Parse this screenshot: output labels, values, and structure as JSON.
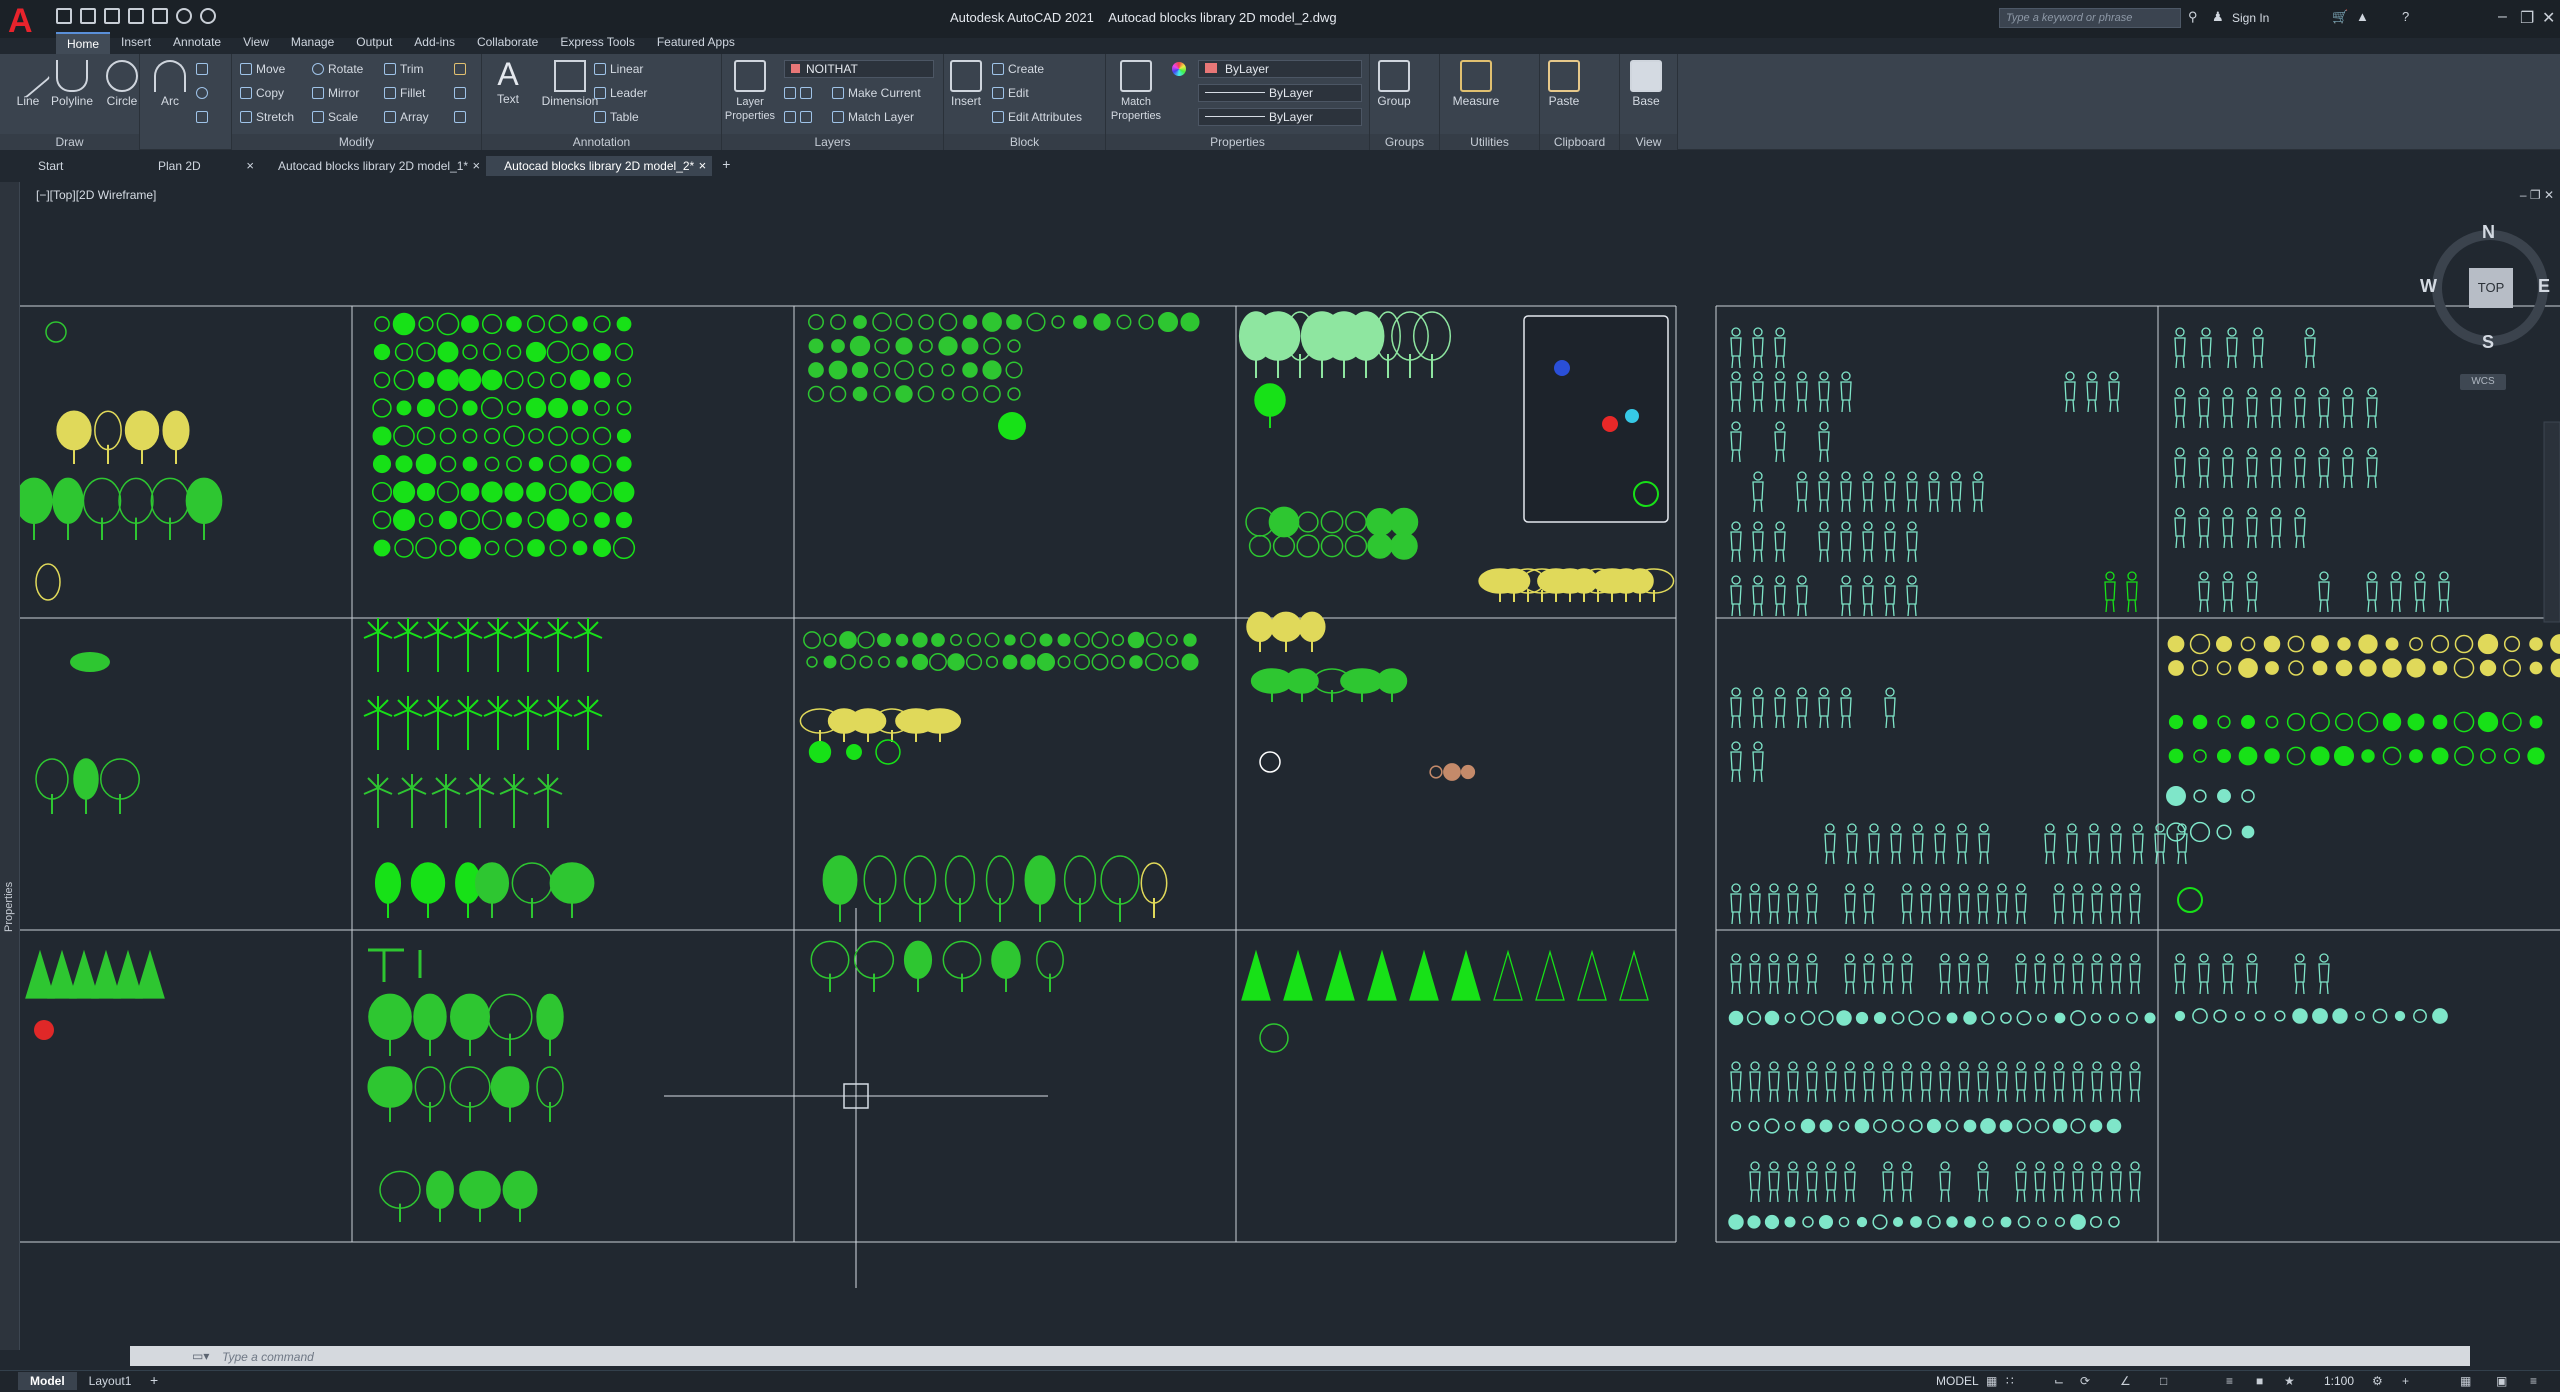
{
  "titlebar": {
    "app_title": "Autodesk AutoCAD 2021",
    "file_title": "Autocad blocks library 2D model_2.dwg",
    "search_placeholder": "Type a keyword or phrase",
    "sign_in": "Sign In"
  },
  "ribbon_tabs": [
    "Home",
    "Insert",
    "Annotate",
    "View",
    "Manage",
    "Output",
    "Add-ins",
    "Collaborate",
    "Express Tools",
    "Featured Apps"
  ],
  "ribbon": {
    "draw": {
      "label": "Draw",
      "line": "Line",
      "polyline": "Polyline",
      "circle": "Circle",
      "arc": "Arc"
    },
    "modify": {
      "label": "Modify",
      "move": "Move",
      "rotate": "Rotate",
      "trim": "Trim",
      "copy": "Copy",
      "mirror": "Mirror",
      "fillet": "Fillet",
      "stretch": "Stretch",
      "scale": "Scale",
      "array": "Array"
    },
    "annotation": {
      "label": "Annotation",
      "text": "Text",
      "dimension": "Dimension",
      "linear": "Linear",
      "leader": "Leader",
      "table": "Table"
    },
    "layers": {
      "label": "Layers",
      "layer_properties": "Layer Properties",
      "current_layer": "NOITHAT",
      "make_current": "Make Current",
      "match_layer": "Match Layer"
    },
    "block": {
      "label": "Block",
      "insert": "Insert",
      "create": "Create",
      "edit": "Edit",
      "edit_attributes": "Edit Attributes"
    },
    "properties": {
      "label": "Properties",
      "match_properties": "Match Properties",
      "color": "ByLayer",
      "linetype": "ByLayer",
      "lineweight": "ByLayer"
    },
    "groups": {
      "label": "Groups",
      "group": "Group"
    },
    "utilities": {
      "label": "Utilities",
      "measure": "Measure"
    },
    "clipboard": {
      "label": "Clipboard",
      "paste": "Paste"
    },
    "view": {
      "label": "View",
      "base": "Base"
    }
  },
  "doc_tabs": [
    "Start",
    "Plan 2D",
    "Autocad blocks library 2D model_1*",
    "Autocad blocks library 2D model_2*"
  ],
  "viewport": {
    "label": "[−][Top][2D Wireframe]"
  },
  "viewcube": {
    "top": "TOP",
    "north": "N",
    "south": "S",
    "east": "E",
    "west": "W",
    "wcs": "WCS"
  },
  "side_palette": "Properties",
  "command": {
    "placeholder": "Type a command"
  },
  "layout_tabs": [
    "Model",
    "Layout1"
  ],
  "status": {
    "model": "MODEL",
    "scale": "1:100"
  },
  "colors": {
    "green": "#2ec631",
    "bright_green": "#17e117",
    "yellow": "#e0d95a",
    "cyan": "#7fe6c9",
    "grid": "#c9cfd6"
  }
}
